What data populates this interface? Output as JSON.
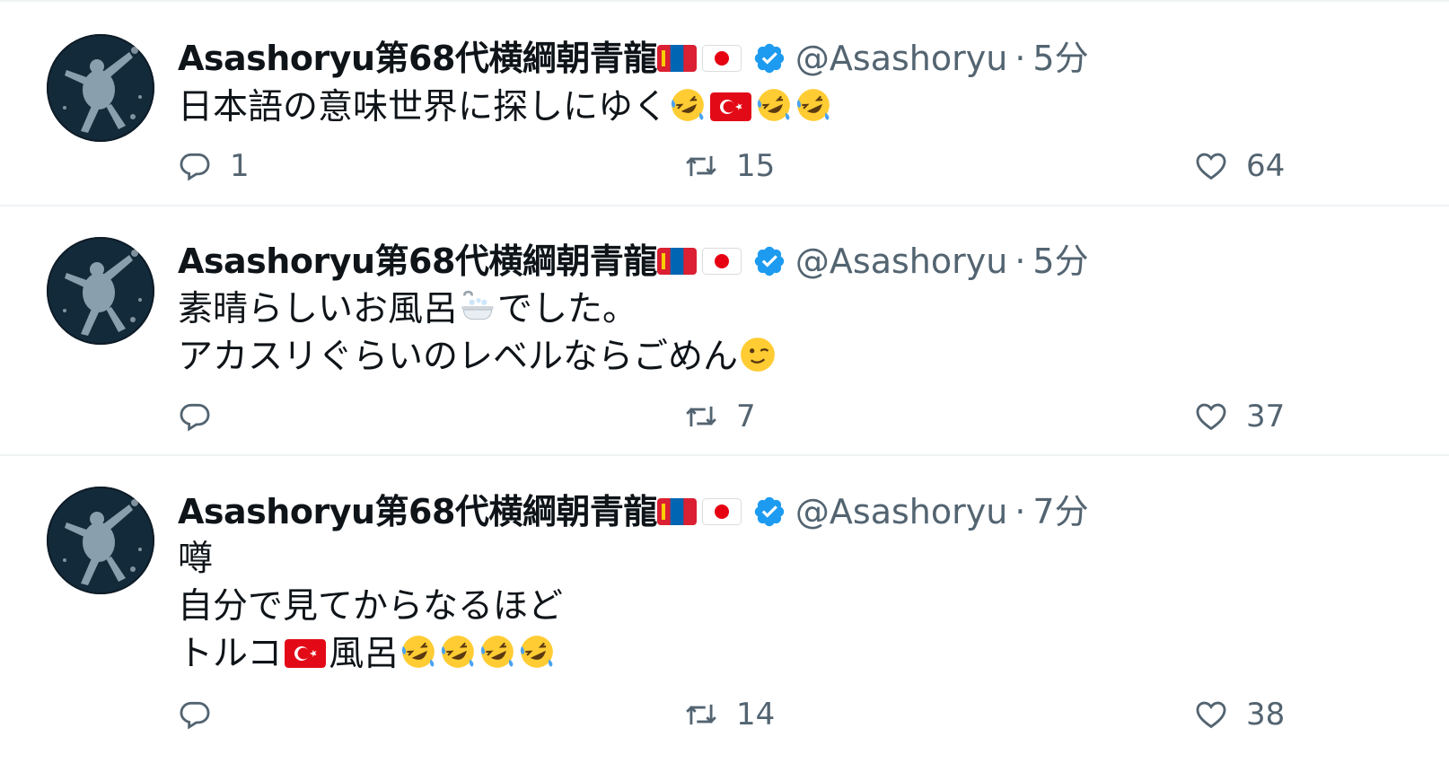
{
  "tweets": [
    {
      "display_name": "Asashoryu第68代横綱朝青龍",
      "handle": "@Asashoryu",
      "separator": "·",
      "time": "5分",
      "text_lines": [
        "日本語の意味世界に探しにゆく"
      ],
      "replies": "1",
      "retweets": "15",
      "likes": "64"
    },
    {
      "display_name": "Asashoryu第68代横綱朝青龍",
      "handle": "@Asashoryu",
      "separator": "·",
      "time": "5分",
      "text_lines": [
        "素晴らしいお風呂",
        "でした。",
        "アカスリぐらいのレベルならごめん"
      ],
      "replies": "",
      "retweets": "7",
      "likes": "37"
    },
    {
      "display_name": "Asashoryu第68代横綱朝青龍",
      "handle": "@Asashoryu",
      "separator": "·",
      "time": "7分",
      "text_lines": [
        "噂",
        "自分で見てからなるほど",
        "トルコ",
        "風呂"
      ],
      "replies": "",
      "retweets": "14",
      "likes": "38"
    }
  ],
  "icons": {
    "reply": "reply-icon",
    "retweet": "retweet-icon",
    "like": "heart-icon",
    "verified": "verified-badge-icon",
    "emoji_laugh": "rolling-on-floor-laughing-emoji",
    "emoji_wink": "winking-face-emoji",
    "emoji_bath": "bathtub-emoji",
    "flag_mongolia": "mongolia-flag-icon",
    "flag_japan": "japan-flag-icon",
    "flag_turkey": "turkey-flag-icon"
  },
  "colors": {
    "text": "#0f1419",
    "secondary": "#536471",
    "verified": "#1d9bf0",
    "divider": "#eff3f4"
  }
}
